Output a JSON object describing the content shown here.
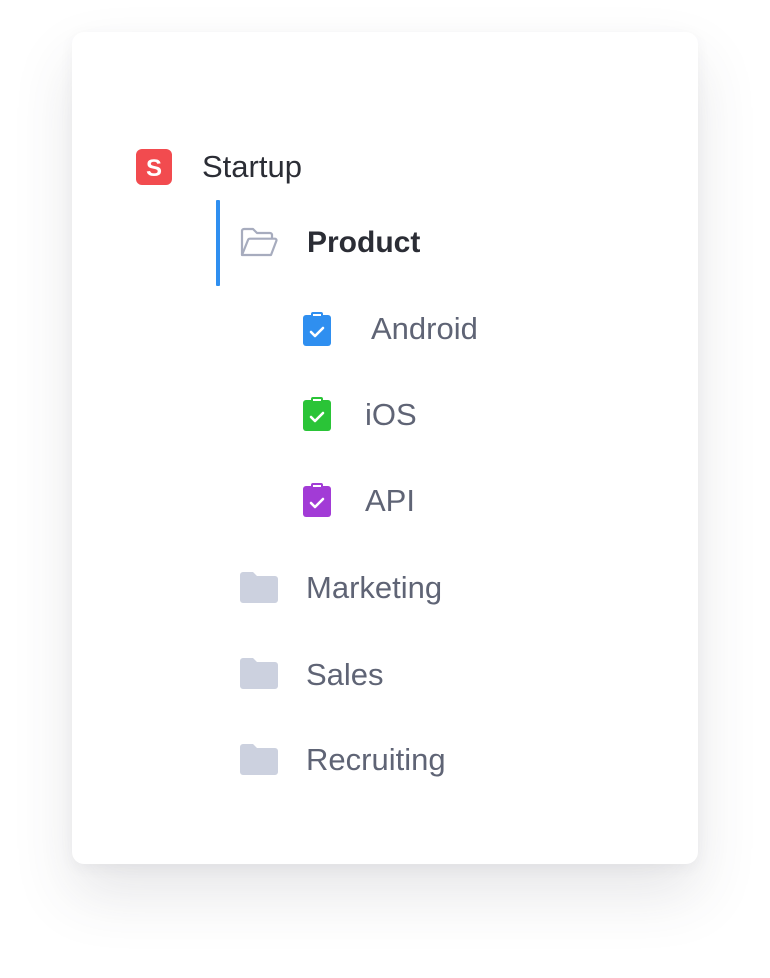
{
  "workspace": {
    "name": "Startup",
    "badge_letter": "S",
    "badge_color": "#f24b4f",
    "icon": "workspace-logo-icon"
  },
  "folders": [
    {
      "name": "Product",
      "active": true,
      "icon": "folder-open-icon",
      "accent_color": "#2f8ff0",
      "lists": [
        {
          "name": "Android",
          "icon": "clipboard-check-icon",
          "color": "#2f8ff0"
        },
        {
          "name": "iOS",
          "icon": "clipboard-check-icon",
          "color": "#2ac437"
        },
        {
          "name": "API",
          "icon": "clipboard-check-icon",
          "color": "#a23bd6"
        }
      ]
    },
    {
      "name": "Marketing",
      "active": false,
      "icon": "folder-icon"
    },
    {
      "name": "Sales",
      "active": false,
      "icon": "folder-icon"
    },
    {
      "name": "Recruiting",
      "active": false,
      "icon": "folder-icon"
    }
  ],
  "colors": {
    "folder_closed": "#ccd1df",
    "folder_open_stroke": "#a7acbe",
    "text_primary": "#2b2d35",
    "text_secondary": "#5f6475"
  }
}
